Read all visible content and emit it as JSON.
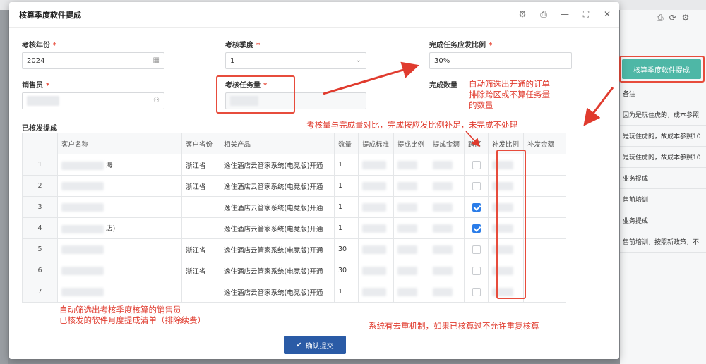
{
  "background": {
    "top_tab_text": "",
    "right_panel": {
      "button_label": "核算季度软件提成",
      "rows": [
        "备注",
        "因为是玩住虎的，成本参照",
        "是玩住虎的，故成本参照10",
        "是玩住虎的，故成本参照10",
        "业务提成",
        "售前培训",
        "业务提成",
        "售前培训，按照新政策，不"
      ]
    }
  },
  "modal": {
    "title": "核算季度软件提成",
    "fields": {
      "year": {
        "label": "考核年份",
        "value": "2024"
      },
      "quarter": {
        "label": "考核季度",
        "value": "1"
      },
      "ratio": {
        "label": "完成任务应发比例",
        "value": "30%"
      },
      "salesperson": {
        "label": "销售员"
      },
      "target": {
        "label": "考核任务量"
      },
      "completed": {
        "label": "完成数量"
      }
    },
    "section_title": "已核发提成",
    "table": {
      "headers": [
        "",
        "客户名称",
        "客户省份",
        "相关产品",
        "数量",
        "提成标准",
        "提成比例",
        "提成金额",
        "跨区",
        "补发比例",
        "补发金额"
      ],
      "rows": [
        {
          "idx": "1",
          "customer": "海",
          "province": "浙江省",
          "product": "逸住酒店云管家系统(电竞版)开通",
          "qty": "1",
          "cross": false
        },
        {
          "idx": "2",
          "customer": "",
          "province": "浙江省",
          "product": "逸住酒店云管家系统(电竞版)开通",
          "qty": "1",
          "cross": false
        },
        {
          "idx": "3",
          "customer": "",
          "province": "",
          "product": "逸住酒店云管家系统(电竞版)开通",
          "qty": "1",
          "cross": true
        },
        {
          "idx": "4",
          "customer": "店)",
          "province": "",
          "product": "逸住酒店云管家系统(电竞版)开通",
          "qty": "1",
          "cross": true
        },
        {
          "idx": "5",
          "customer": "",
          "province": "浙江省",
          "product": "逸住酒店云管家系统(电竞版)开通",
          "qty": "30",
          "cross": false
        },
        {
          "idx": "6",
          "customer": "",
          "province": "浙江省",
          "product": "逸住酒店云管家系统(电竞版)开通",
          "qty": "30",
          "cross": false
        },
        {
          "idx": "7",
          "customer": "",
          "province": "",
          "product": "逸住酒店云管家系统(电竞版)开通",
          "qty": "1",
          "cross": false
        }
      ]
    },
    "confirm_label": "确认提交"
  },
  "annotations": {
    "auto_filter": [
      "自动筛选出开通的订单",
      "排除跨区或不算任务量",
      "的数量"
    ],
    "compare": "考核量与完成量对比，完成按应发比例补足，未完成不处理",
    "auto_list": [
      "自动筛选出考核季度核算的销售员",
      "已核发的软件月度提成清单（排除续费）"
    ],
    "dedup": "系统有去重机制，如果已核算过不允许重复核算"
  },
  "colors": {
    "accent_red": "#e03b2e",
    "primary_blue": "#2a5ba6",
    "teal": "#4eb7a6",
    "checkbox_blue": "#2b7de9"
  },
  "icons": [
    "gear-icon",
    "print-icon",
    "minimize-icon",
    "maximize-icon",
    "close-icon",
    "calendar-icon",
    "chevron-down-icon",
    "people-icon",
    "check-icon"
  ]
}
